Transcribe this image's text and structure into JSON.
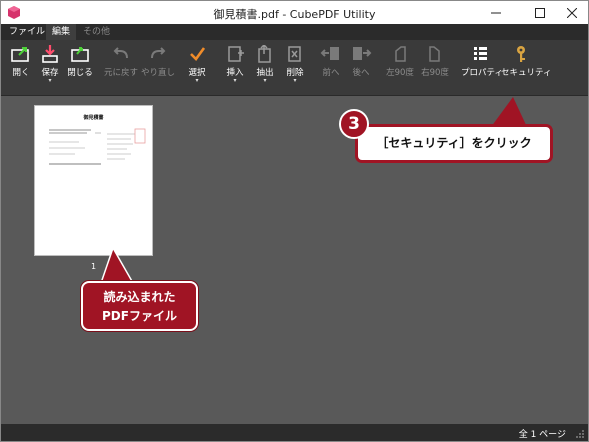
{
  "window": {
    "title": "御見積書.pdf - CubePDF Utility"
  },
  "menu": {
    "tabs": [
      {
        "label": "ファイル"
      },
      {
        "label": "編集"
      },
      {
        "label": "その他"
      }
    ]
  },
  "toolbar": {
    "open": "開く",
    "save": "保存",
    "close": "閉じる",
    "undo": "元に戻す",
    "redo": "やり直し",
    "select": "選択",
    "insert": "挿入",
    "extract": "抽出",
    "delete": "削除",
    "prev": "前へ",
    "next": "後へ",
    "rotate_left": "左90度",
    "rotate_right": "右90度",
    "properties": "プロパティ",
    "security": "セキュリティ"
  },
  "document": {
    "thumb_title": "御見積書",
    "pages": [
      {
        "number": "1"
      }
    ]
  },
  "annotations": {
    "step_number": "3",
    "security_callout": "［セキュリティ］をクリック",
    "loaded_callout_line1": "読み込まれた",
    "loaded_callout_line2": "PDFファイル"
  },
  "status": {
    "page_count": "全 1 ページ"
  },
  "colors": {
    "accent_red": "#a01424",
    "toolbar_bg": "#3a3a3a",
    "content_bg": "#595959"
  }
}
